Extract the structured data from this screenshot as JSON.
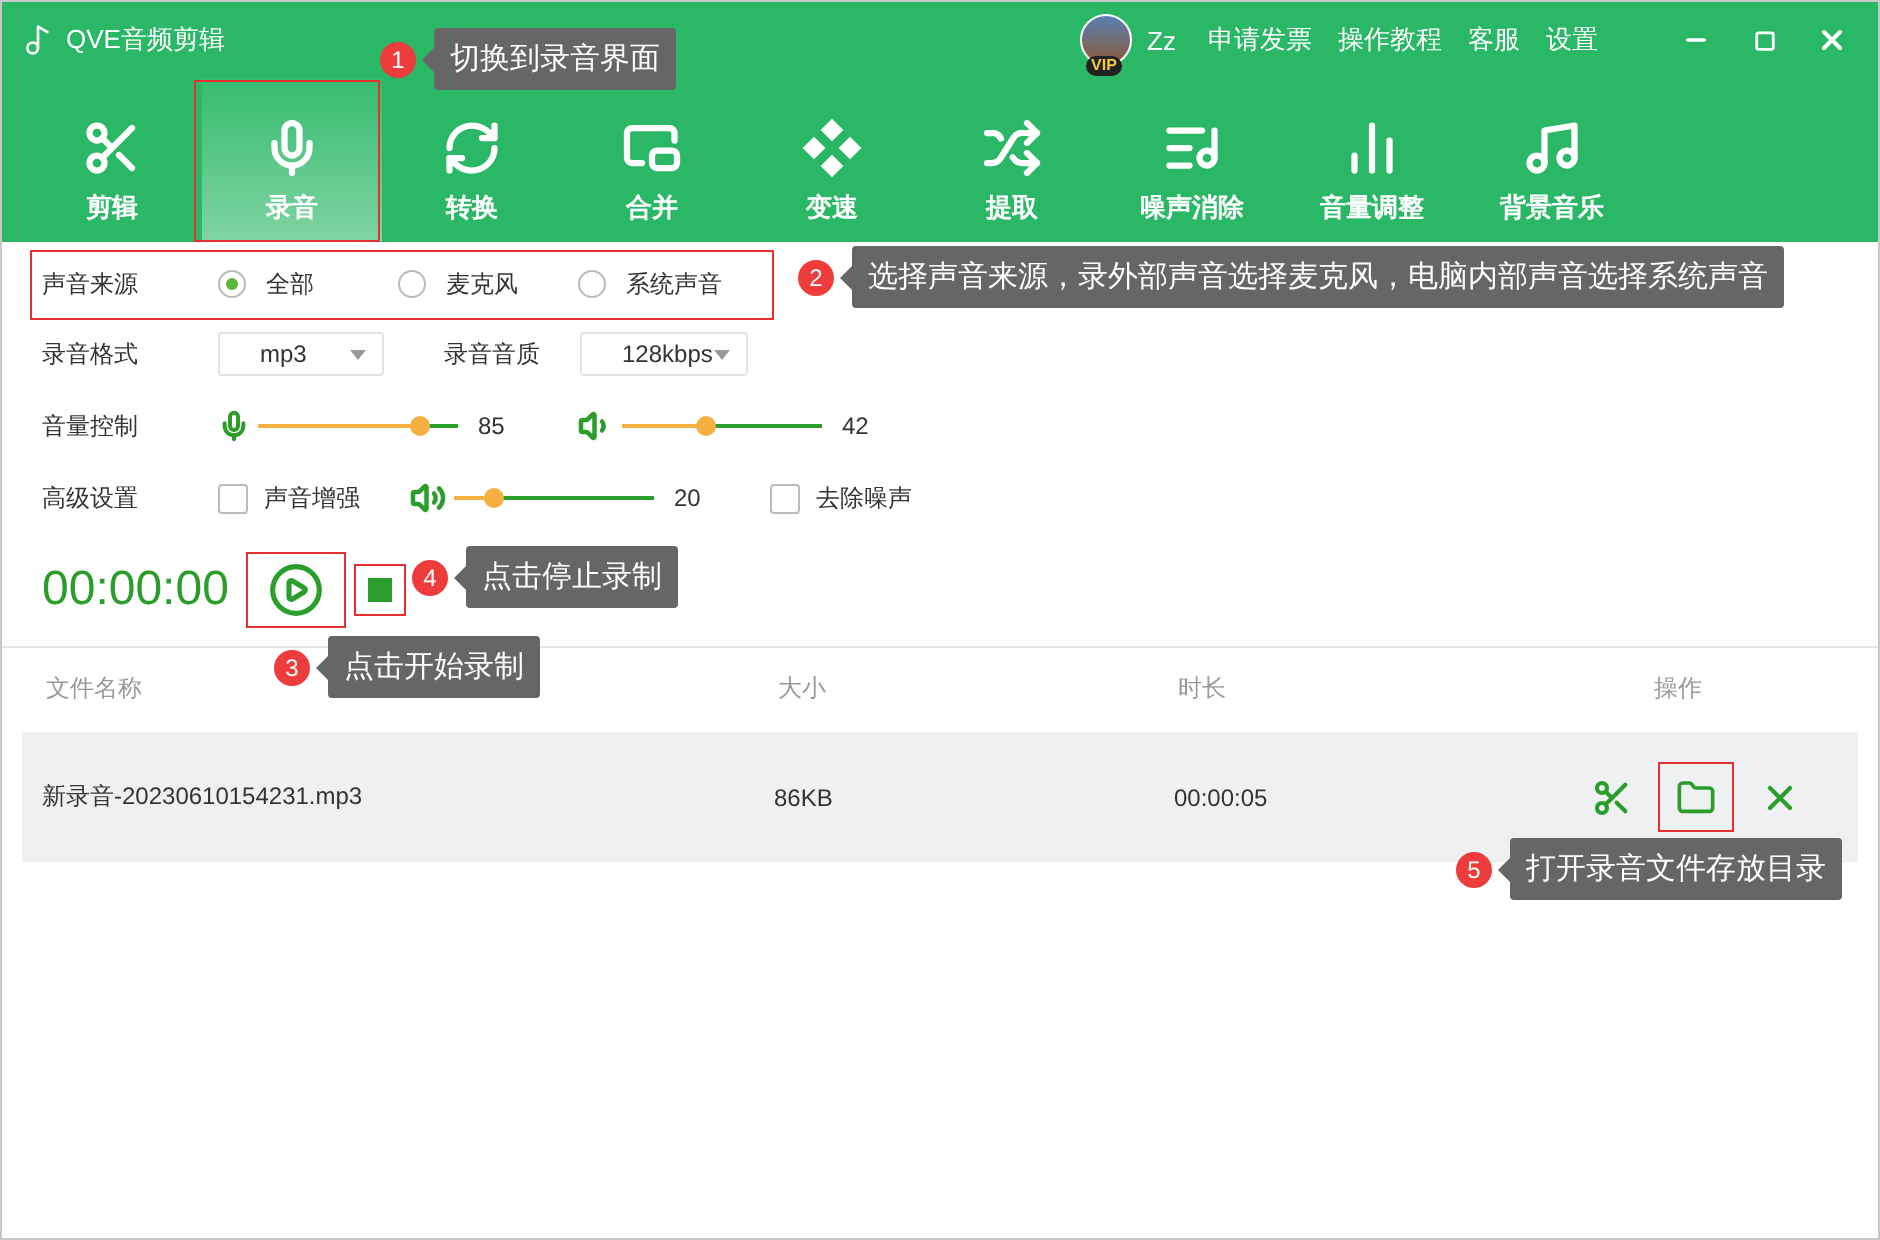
{
  "window": {
    "title": "QVE音频剪辑",
    "user": "Zz",
    "vip_badge": "VIP",
    "links": [
      "申请发票",
      "操作教程",
      "客服",
      "设置"
    ]
  },
  "tabs": [
    {
      "kind": "scissors",
      "label": "剪辑",
      "selected": false
    },
    {
      "kind": "mic",
      "label": "录音",
      "selected": true
    },
    {
      "kind": "convert",
      "label": "转换",
      "selected": false
    },
    {
      "kind": "merge",
      "label": "合并",
      "selected": false
    },
    {
      "kind": "speed",
      "label": "变速",
      "selected": false
    },
    {
      "kind": "extract",
      "label": "提取",
      "selected": false
    },
    {
      "kind": "denoise",
      "label": "噪声消除",
      "selected": false
    },
    {
      "kind": "volume",
      "label": "音量调整",
      "selected": false
    },
    {
      "kind": "music",
      "label": "背景音乐",
      "selected": false
    }
  ],
  "source": {
    "label": "声音来源",
    "options": [
      {
        "label": "全部",
        "selected": true
      },
      {
        "label": "麦克风",
        "selected": false
      },
      {
        "label": "系统声音",
        "selected": false
      }
    ]
  },
  "format": {
    "label": "录音格式",
    "value": "mp3",
    "quality_label": "录音音质",
    "quality": "128kbps"
  },
  "volume": {
    "label": "音量控制",
    "mic": {
      "level": 0.81,
      "reading": "85"
    },
    "system": {
      "level": 0.42,
      "reading": "42"
    }
  },
  "advanced": {
    "label": "高级设置",
    "enhance": {
      "label": "声音增强",
      "checked": false
    },
    "enhance_level": {
      "level": 0.2,
      "reading": "20"
    },
    "denoise": {
      "label": "去除噪声",
      "checked": false
    }
  },
  "timer": "00:00:00",
  "table": {
    "columns": [
      "文件名称",
      "大小",
      "时长",
      "操作"
    ],
    "rows": [
      {
        "name": "新录音-20230610154231.mp3",
        "size": "86KB",
        "duration": "00:00:05"
      }
    ]
  },
  "callouts": [
    {
      "number": "1",
      "text": "切换到录音界面"
    },
    {
      "number": "2",
      "text": "选择声音来源，录外部声音选择麦克风，电脑内部声音选择系统声音"
    },
    {
      "number": "3",
      "text": "点击开始录制"
    },
    {
      "number": "4",
      "text": "点击停止录制"
    },
    {
      "number": "5",
      "text": "打开录音文件存放目录"
    }
  ]
}
